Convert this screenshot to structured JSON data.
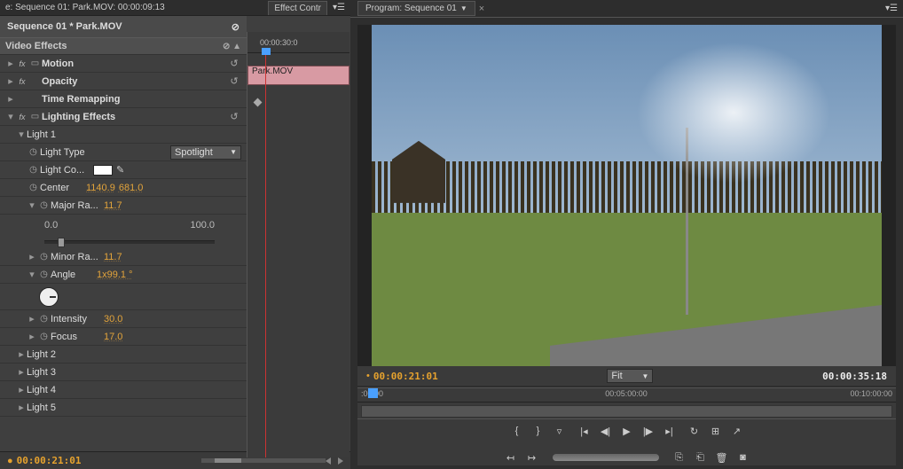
{
  "header": {
    "source_tab": "e: Sequence 01: Park.MOV: 00:00:09:13",
    "effect_tab": "Effect Contr"
  },
  "seq_title": "Sequence 01 * Park.MOV",
  "section_ve": "Video Effects",
  "clip_name": "Park.MOV",
  "effects": {
    "motion": "Motion",
    "opacity": "Opacity",
    "timeremap": "Time Remapping",
    "lighting": "Lighting Effects"
  },
  "light1": {
    "name": "Light 1",
    "lighttype_lbl": "Light Type",
    "lighttype_val": "Spotlight",
    "lightco_lbl": "Light Co...",
    "center_lbl": "Center",
    "center_x": "1140.9",
    "center_y": "681.0",
    "majorra_lbl": "Major Ra...",
    "majorra_val": "11.7",
    "slider_min": "0.0",
    "slider_max": "100.0",
    "minorra_lbl": "Minor Ra...",
    "minorra_val": "11.7",
    "angle_lbl": "Angle",
    "angle_val": "1x99.1 °",
    "intensity_lbl": "Intensity",
    "intensity_val": "30.0",
    "focus_lbl": "Focus",
    "focus_val": "17.0"
  },
  "lights_other": [
    "Light 2",
    "Light 3",
    "Light 4",
    "Light 5"
  ],
  "timeline_ruler": "00:00:30:0",
  "footer_tc": "00:00:21:01",
  "program": {
    "tab": "Program: Sequence 01",
    "tc_current": "00:00:21:01",
    "fit": "Fit",
    "tc_dur": "00:00:35:18",
    "ruler": {
      "t1": ":00:00",
      "t2": "00:05:00:00",
      "t3": "00:10:00:00"
    },
    "marker": "•"
  }
}
